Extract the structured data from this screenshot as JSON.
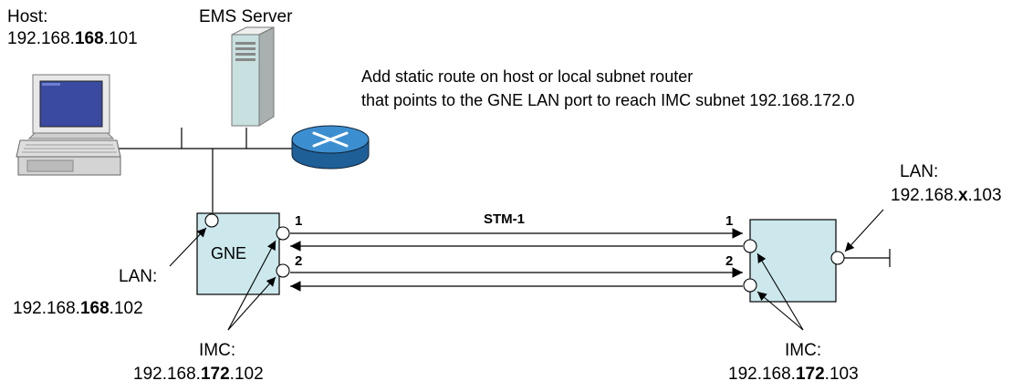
{
  "host": {
    "label": "Host:",
    "ip_a": "192.168.",
    "ip_b": "168",
    "ip_c": ".101"
  },
  "ems": {
    "label": "EMS Server"
  },
  "note": {
    "line1": "Add static route on host or local subnet router",
    "line2": "that points to the GNE LAN port to reach IMC subnet 192.168.172.0"
  },
  "gne": {
    "label": "GNE",
    "lan_label": "LAN:",
    "lan_a": "192.168.",
    "lan_b": "168",
    "lan_c": ".102",
    "imc_label": "IMC:",
    "imc_a": "192.168.",
    "imc_b": "172",
    "imc_c": ".102"
  },
  "remote": {
    "lan_label": "LAN:",
    "lan_a": "192.168.",
    "lan_b": "x",
    "lan_c": ".103",
    "imc_label": "IMC:",
    "imc_a": "192.168.",
    "imc_b": "172",
    "imc_c": ".103"
  },
  "link": {
    "label": "STM-1",
    "port1": "1",
    "port2": "2"
  },
  "colors": {
    "box_fill": "#cce8ec",
    "router_top": "#3b8fd0",
    "router_side": "#1e5f98"
  }
}
